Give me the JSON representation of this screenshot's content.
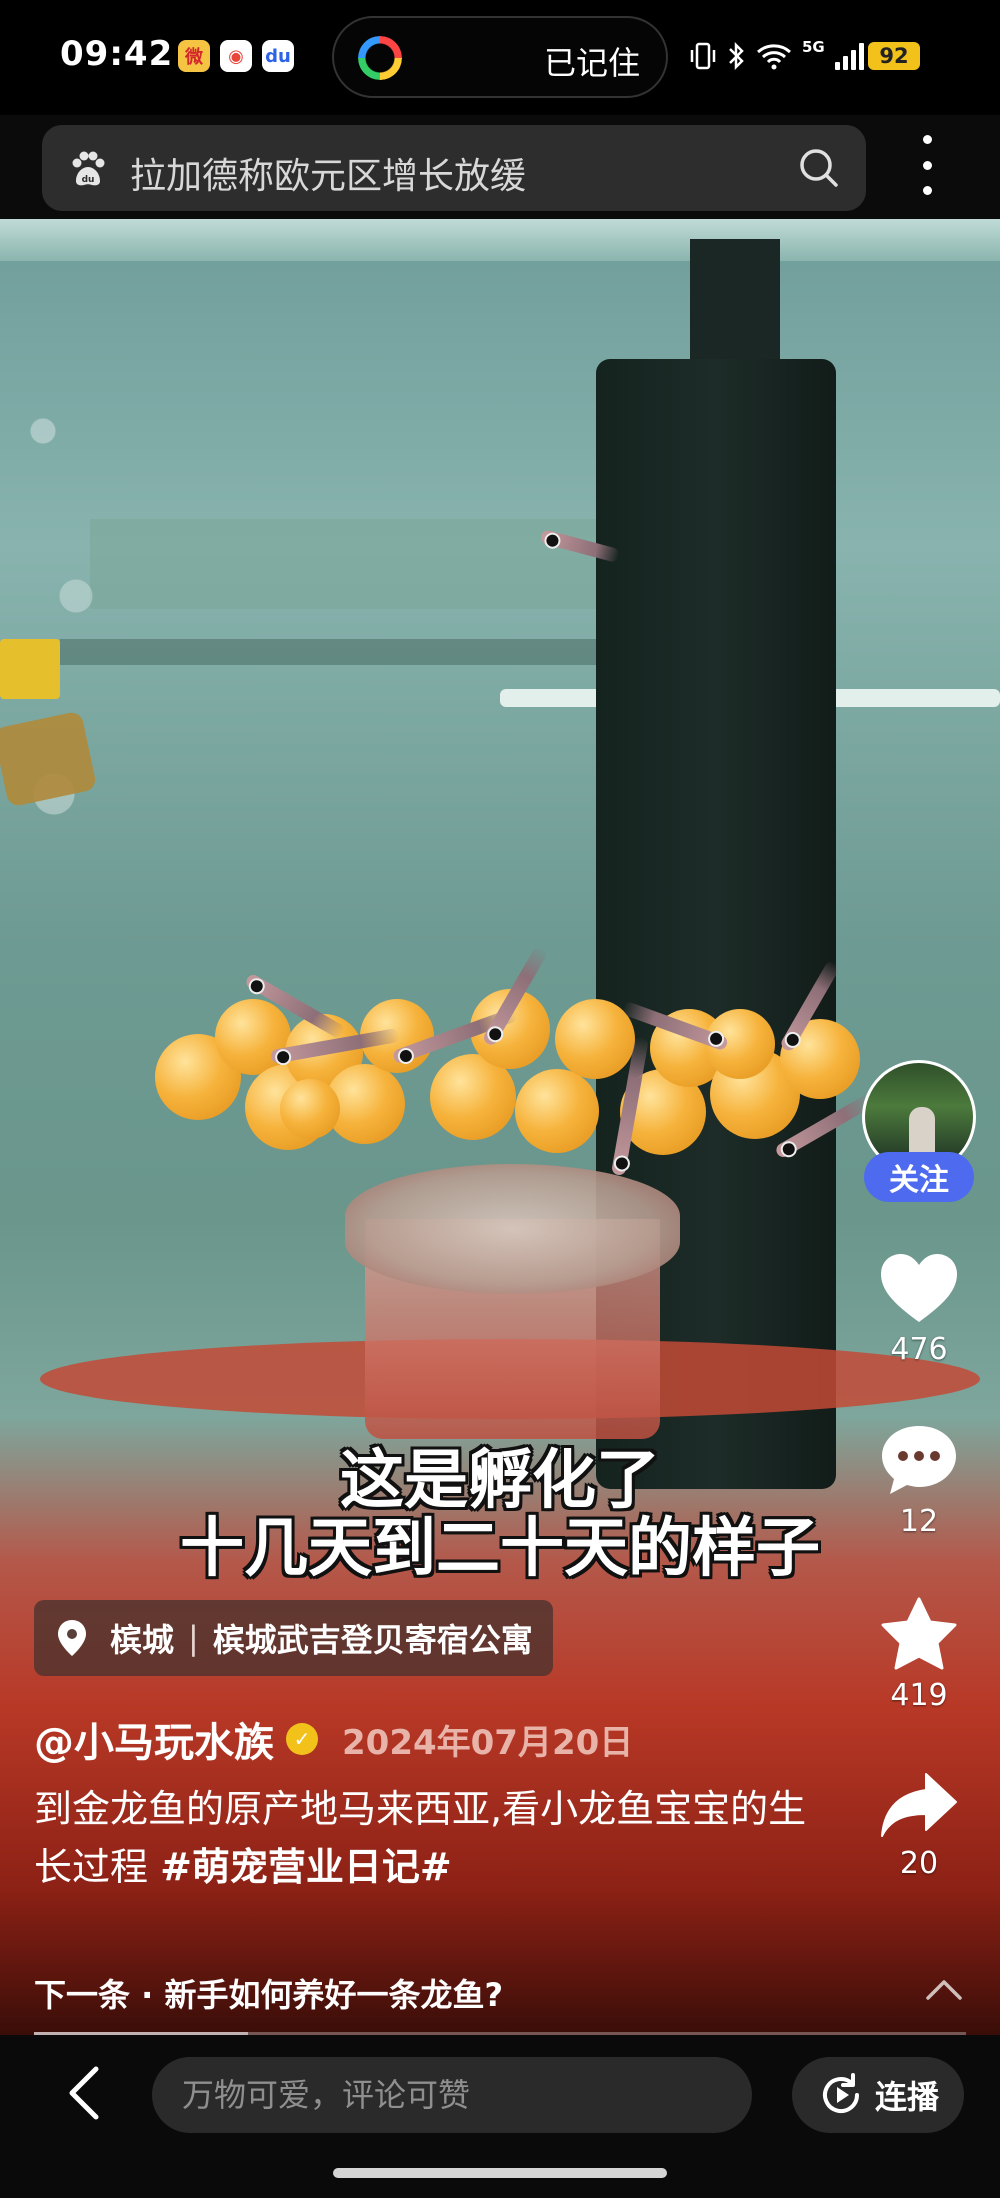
{
  "status_bar": {
    "time": "09:42",
    "app_icons": [
      "weibo-icon",
      "map-icon",
      "baidu-icon"
    ],
    "island_text": "已记住",
    "network": "5G",
    "battery": "92"
  },
  "search": {
    "query": "拉加德称欧元区增长放缓"
  },
  "video": {
    "caption_line1": "这是孵化了",
    "caption_line2": "十几天到二十天的样子",
    "progress_fraction": 0.23
  },
  "actions": {
    "follow_label": "关注",
    "likes": "476",
    "comments": "12",
    "favorites": "419",
    "shares": "20"
  },
  "post": {
    "location_city": "槟城",
    "location_place": "槟城武吉登贝寄宿公寓",
    "author": "@小马玩水族",
    "date": "2024年07月20日",
    "description": "到金龙鱼的原产地马来西亚,看小龙鱼宝宝的生长过程 ",
    "hashtag": "#萌宠营业日记#"
  },
  "next": {
    "label": "下一条 · 新手如何养好一条龙鱼?"
  },
  "bottom_bar": {
    "comment_placeholder": "万物可爱，评论可赞",
    "liveplay_label": "连播"
  },
  "colors": {
    "follow_button": "#4e6bf0",
    "battery": "#f2c21a",
    "date_text": "#e8b3a9"
  }
}
